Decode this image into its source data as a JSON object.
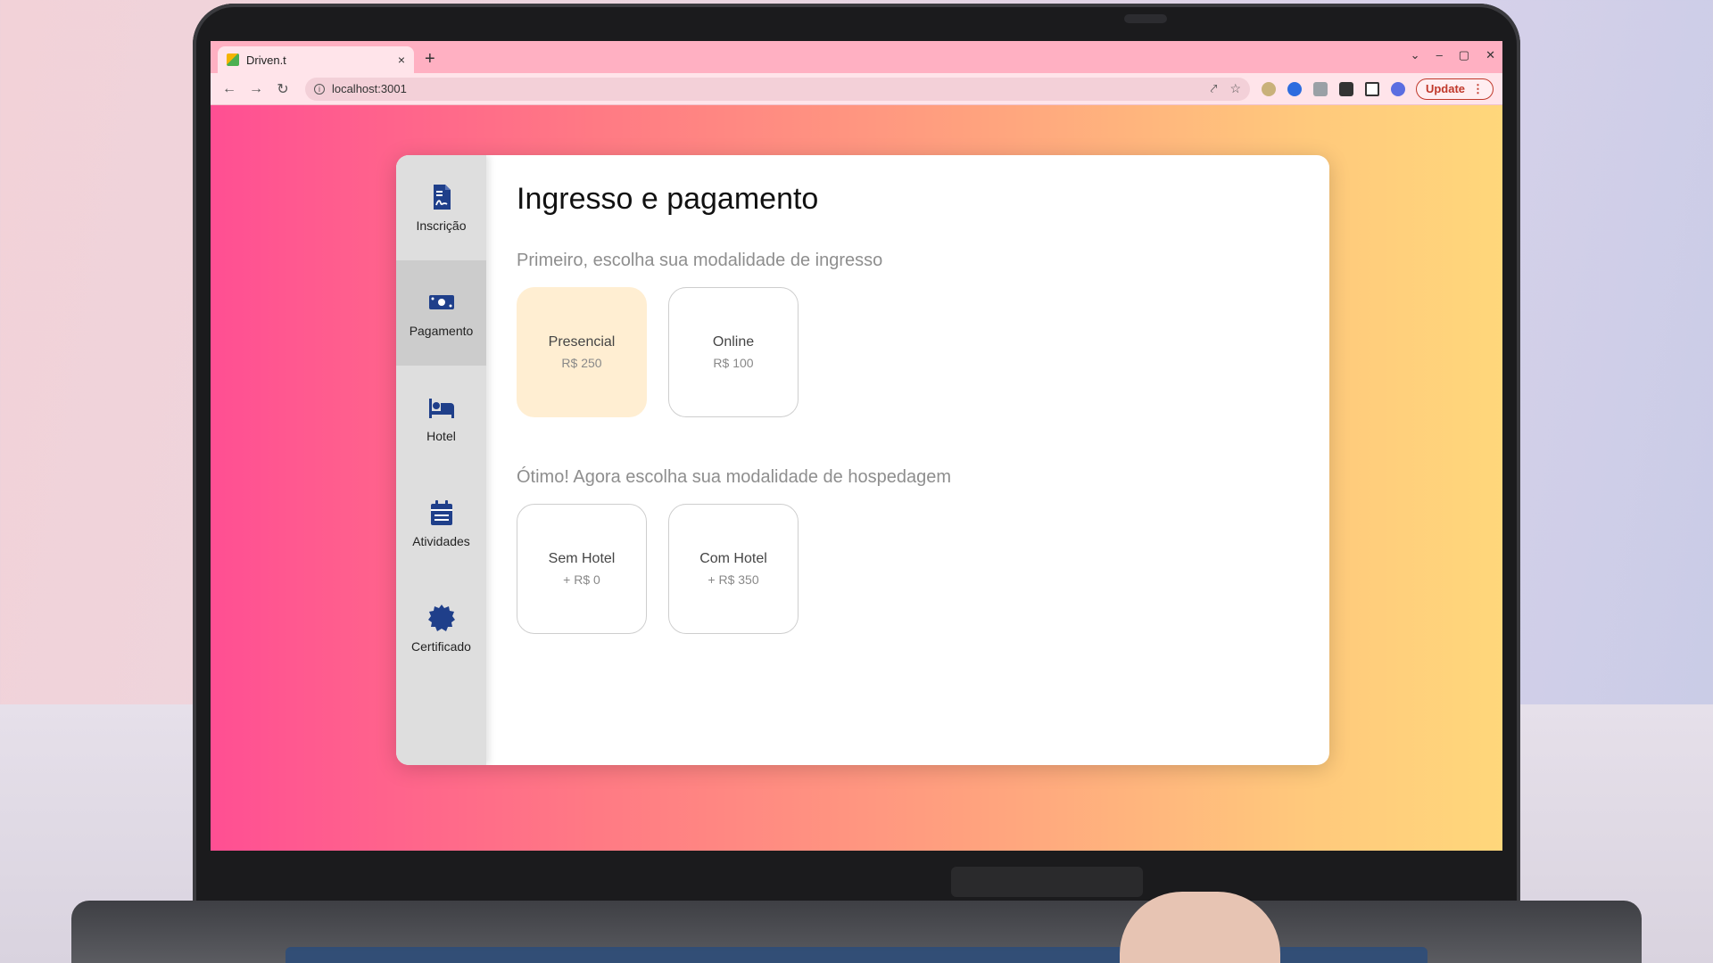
{
  "browser": {
    "tab_title": "Driven.t",
    "tab_close": "×",
    "new_tab": "+",
    "url": "localhost:3001",
    "update_label": "Update",
    "window_controls": [
      "⌄",
      "–",
      "▢",
      "✕"
    ]
  },
  "sidebar": {
    "items": [
      {
        "label": "Inscrição",
        "icon": "file-signature-icon"
      },
      {
        "label": "Pagamento",
        "icon": "money-bill-icon",
        "active": true
      },
      {
        "label": "Hotel",
        "icon": "bed-icon"
      },
      {
        "label": "Atividades",
        "icon": "calendar-icon"
      },
      {
        "label": "Certificado",
        "icon": "certificate-icon"
      }
    ]
  },
  "main": {
    "title": "Ingresso e pagamento",
    "ticket_section": {
      "label": "Primeiro, escolha sua modalidade de ingresso",
      "options": [
        {
          "name": "Presencial",
          "price": "R$ 250",
          "selected": true
        },
        {
          "name": "Online",
          "price": "R$ 100",
          "selected": false
        }
      ]
    },
    "hotel_section": {
      "label": "Ótimo! Agora escolha sua modalidade de hospedagem",
      "options": [
        {
          "name": "Sem Hotel",
          "price": "+ R$ 0",
          "selected": false
        },
        {
          "name": "Com Hotel",
          "price": "+ R$ 350",
          "selected": false
        }
      ]
    }
  },
  "colors": {
    "brand_icon": "#1f3f8a",
    "selected_card": "#ffeed2",
    "gradient_start": "#ff4f93",
    "gradient_end": "#ffd77b"
  }
}
